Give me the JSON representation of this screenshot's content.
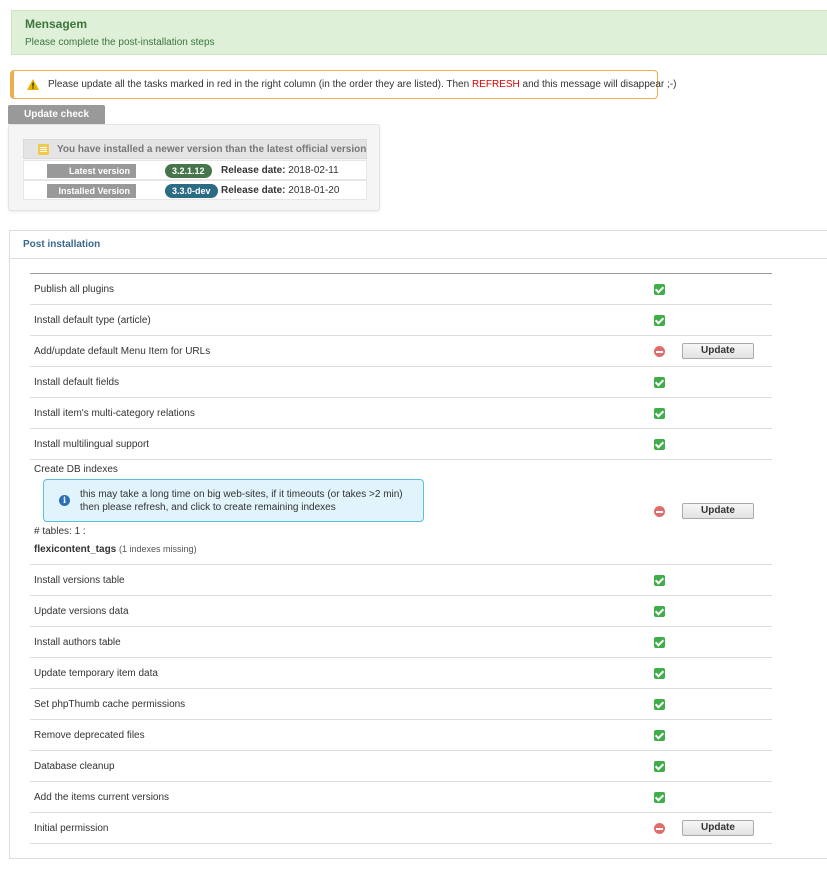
{
  "message": {
    "title": "Mensagem",
    "text": "Please complete the post-installation steps"
  },
  "warning": {
    "text_before": "Please update all the tasks marked in red in the right column (in the order they are listed). Then ",
    "refresh": "REFRESH",
    "text_after": " and this message will disappear ;-)"
  },
  "update_check": {
    "button_label": "Update check",
    "header": "You have installed a newer version than the latest official version",
    "latest": {
      "label": "Latest version",
      "version": "3.2.1.12",
      "release_label": "Release date:",
      "release_date": "2018-02-11"
    },
    "installed": {
      "label": "Installed Version",
      "version": "3.3.0-dev",
      "release_label": "Release date:",
      "release_date": "2018-01-20"
    }
  },
  "post_install": {
    "title": "Post installation",
    "update_label": "Update",
    "tasks": [
      {
        "label": "Publish all plugins",
        "status": "ok"
      },
      {
        "label": "Install default type (article)",
        "status": "ok"
      },
      {
        "label": "Add/update default Menu Item for URLs",
        "status": "error"
      },
      {
        "label": "Install default fields",
        "status": "ok"
      },
      {
        "label": "Install item's multi-category relations",
        "status": "ok"
      },
      {
        "label": "Install multilingual support",
        "status": "ok"
      },
      {
        "label": "Create DB indexes",
        "status": "error"
      },
      {
        "label": "Install versions table",
        "status": "ok"
      },
      {
        "label": "Update versions data",
        "status": "ok"
      },
      {
        "label": "Install authors table",
        "status": "ok"
      },
      {
        "label": "Update temporary item data",
        "status": "ok"
      },
      {
        "label": "Set phpThumb cache permissions",
        "status": "ok"
      },
      {
        "label": "Remove deprecated files",
        "status": "ok"
      },
      {
        "label": "Database cleanup",
        "status": "ok"
      },
      {
        "label": "Add the items current versions",
        "status": "ok"
      },
      {
        "label": "Initial permission",
        "status": "error"
      }
    ],
    "db_indexes": {
      "info": "this may take a long time on big web-sites, if it timeouts (or takes >2 min) then please refresh, and click to create remaining indexes",
      "tables_count": "# tables: 1 :",
      "table_name": "flexicontent_tags",
      "missing": "(1 indexes missing)"
    }
  },
  "colors": {
    "success_bg": "#dff0d8",
    "warning_border": "#f0ad4e",
    "ok_green": "#3fae49",
    "error_red": "#e06c6c",
    "refresh_red": "#dd0000"
  }
}
